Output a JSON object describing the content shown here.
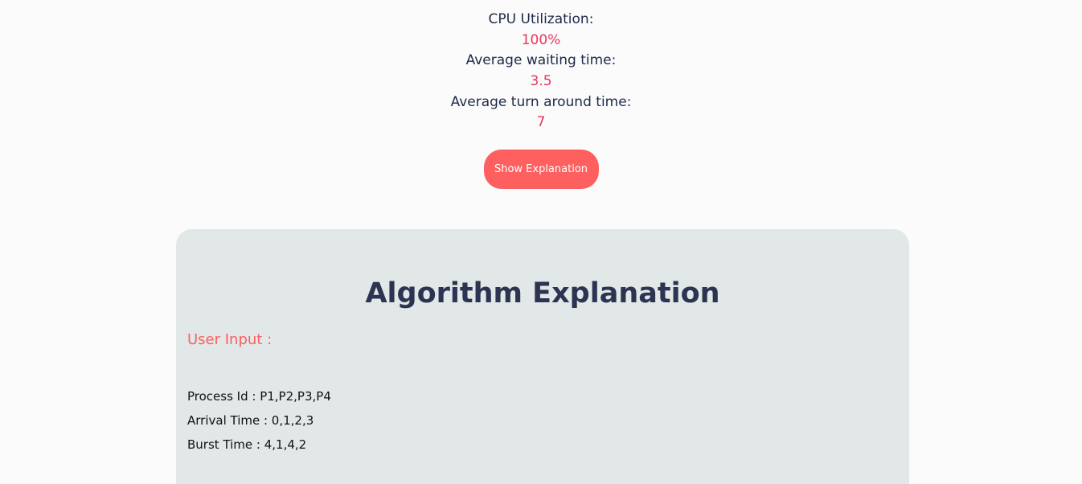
{
  "stats": {
    "cpu_utilization_label": "CPU Utilization:",
    "cpu_utilization_value": "100%",
    "avg_waiting_label": "Average waiting time:",
    "avg_waiting_value": "3.5",
    "avg_turnaround_label": "Average turn around time:",
    "avg_turnaround_value": "7"
  },
  "show_explanation_button": "Show Explanation",
  "explanation": {
    "title": "Algorithm Explanation",
    "user_input_label": "User Input :",
    "process_id": "Process Id : P1,P2,P3,P4",
    "arrival_time": "Arrival Time : 0,1,2,3",
    "burst_time": "Burst Time : 4,1,4,2"
  },
  "colors": {
    "label_text": "#1e2a4a",
    "value_text": "#e8355d",
    "button_bg": "#fe5f5f",
    "panel_bg": "#e2e7e7",
    "title_text": "#2c3452",
    "accent": "#fe5f5f"
  }
}
